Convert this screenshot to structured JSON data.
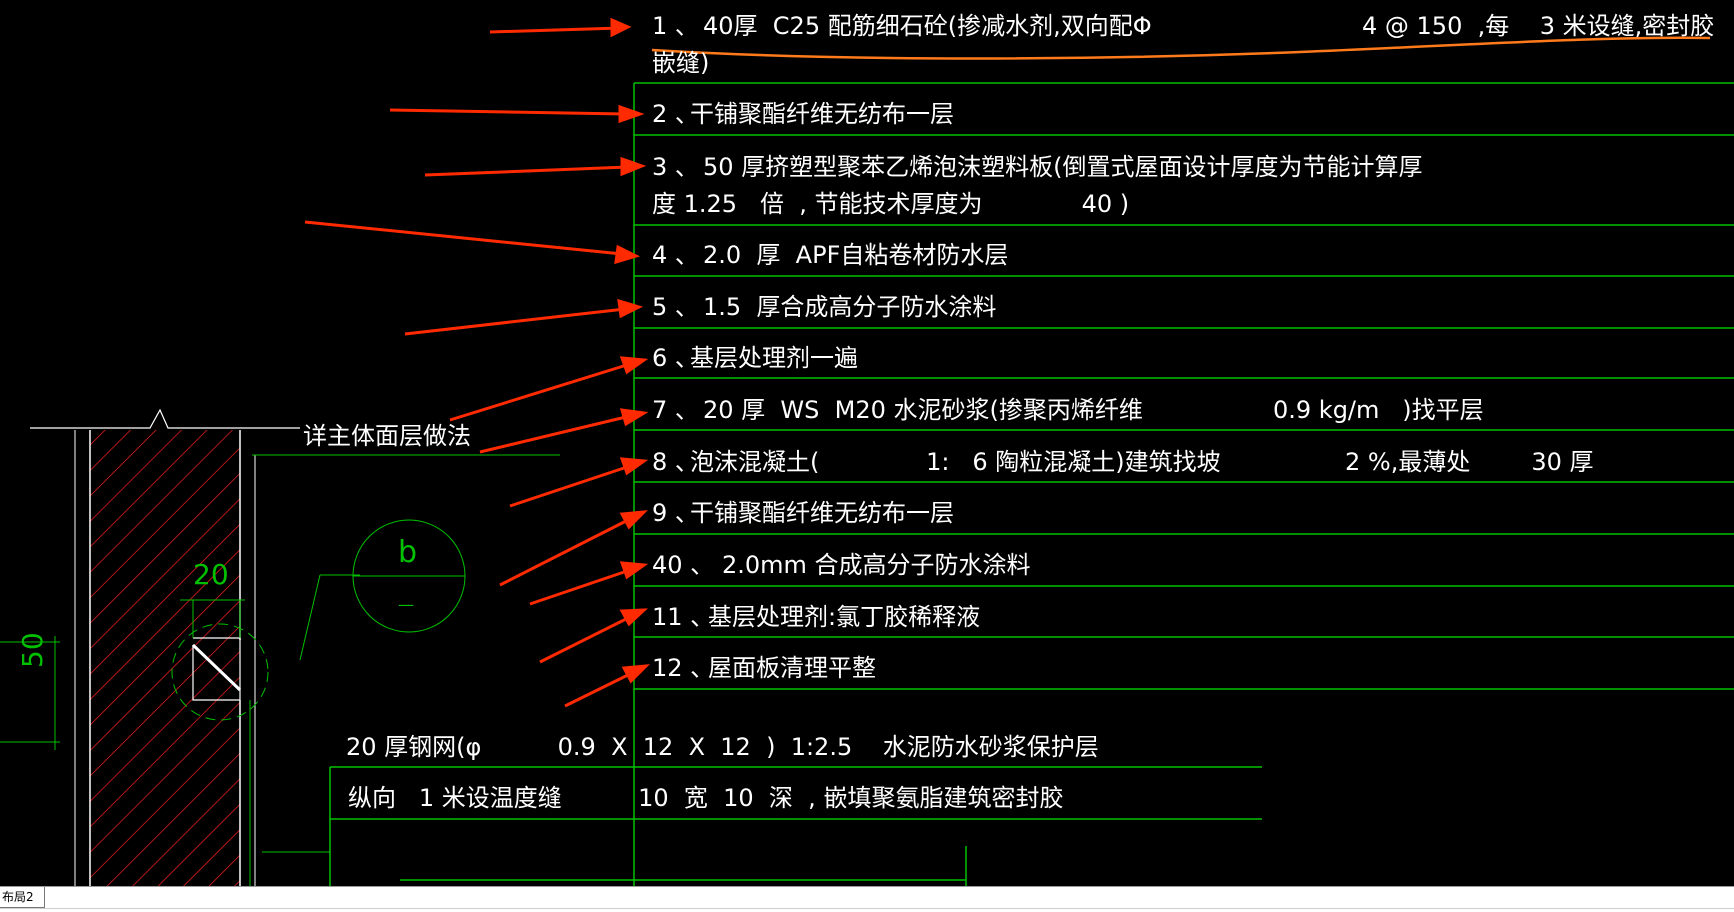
{
  "layers": [
    {
      "num": "1 、",
      "text": "40厚  C25 配筋细石砼(掺减水剂,双向配Φ",
      "text2": "4 @ 150  ,每    3 米设缝,密封胶",
      "text3": "嵌缝)"
    },
    {
      "num": "2 、",
      "text": "干铺聚酯纤维无纺布一层"
    },
    {
      "num": "3 、",
      "text": "50 厚挤塑型聚苯乙烯泡沫塑料板(倒置式屋面设计厚度为节能计算厚",
      "text3": "度 1.25   倍  , 节能技术厚度为             40 )"
    },
    {
      "num": "4 、",
      "text": "2.0  厚  APF自粘卷材防水层"
    },
    {
      "num": "5 、",
      "text": "1.5  厚合成高分子防水涂料"
    },
    {
      "num": "6 、",
      "text": "基层处理剂一遍"
    },
    {
      "num": "7 、",
      "text": "20 厚  WS  M20 水泥砂浆(掺聚丙烯纤维",
      "text2": "0.9 kg/m   )找平层"
    },
    {
      "num": "8 、",
      "text": "泡沫混凝土(              1:   6 陶粒混凝土)建筑找坡",
      "text2": "2 %,最薄处        30 厚"
    },
    {
      "num": "9 、",
      "text": "干铺聚酯纤维无纺布一层"
    },
    {
      "num": "40 、",
      "text": "2.0mm 合成高分子防水涂料"
    },
    {
      "num": "11 、",
      "text": "基层处理剂:氯丁胶稀释液"
    },
    {
      "num": "12 、",
      "text": "屋面板清理平整"
    }
  ],
  "wall_notes": {
    "line1": "20 厚钢网(φ          0.9  X  12  X  12  )  1:2.5    水泥防水砂浆保护层",
    "line2": "纵向   1 米设温度缝          10  宽  10  深  , 嵌填聚氨脂建筑密封胶"
  },
  "detail_label": "详主体面层做法",
  "bubble": {
    "letter": "b",
    "sub": "—"
  },
  "dims": {
    "d20": "20",
    "d50": "50"
  },
  "layout_tab": "布局2",
  "colors": {
    "background": "#000000",
    "text": "#ffffff",
    "cad_line": "#00c000",
    "arrow": "#ff2a00",
    "underline": "#ff7a1a",
    "hatch": "#ff2020"
  }
}
